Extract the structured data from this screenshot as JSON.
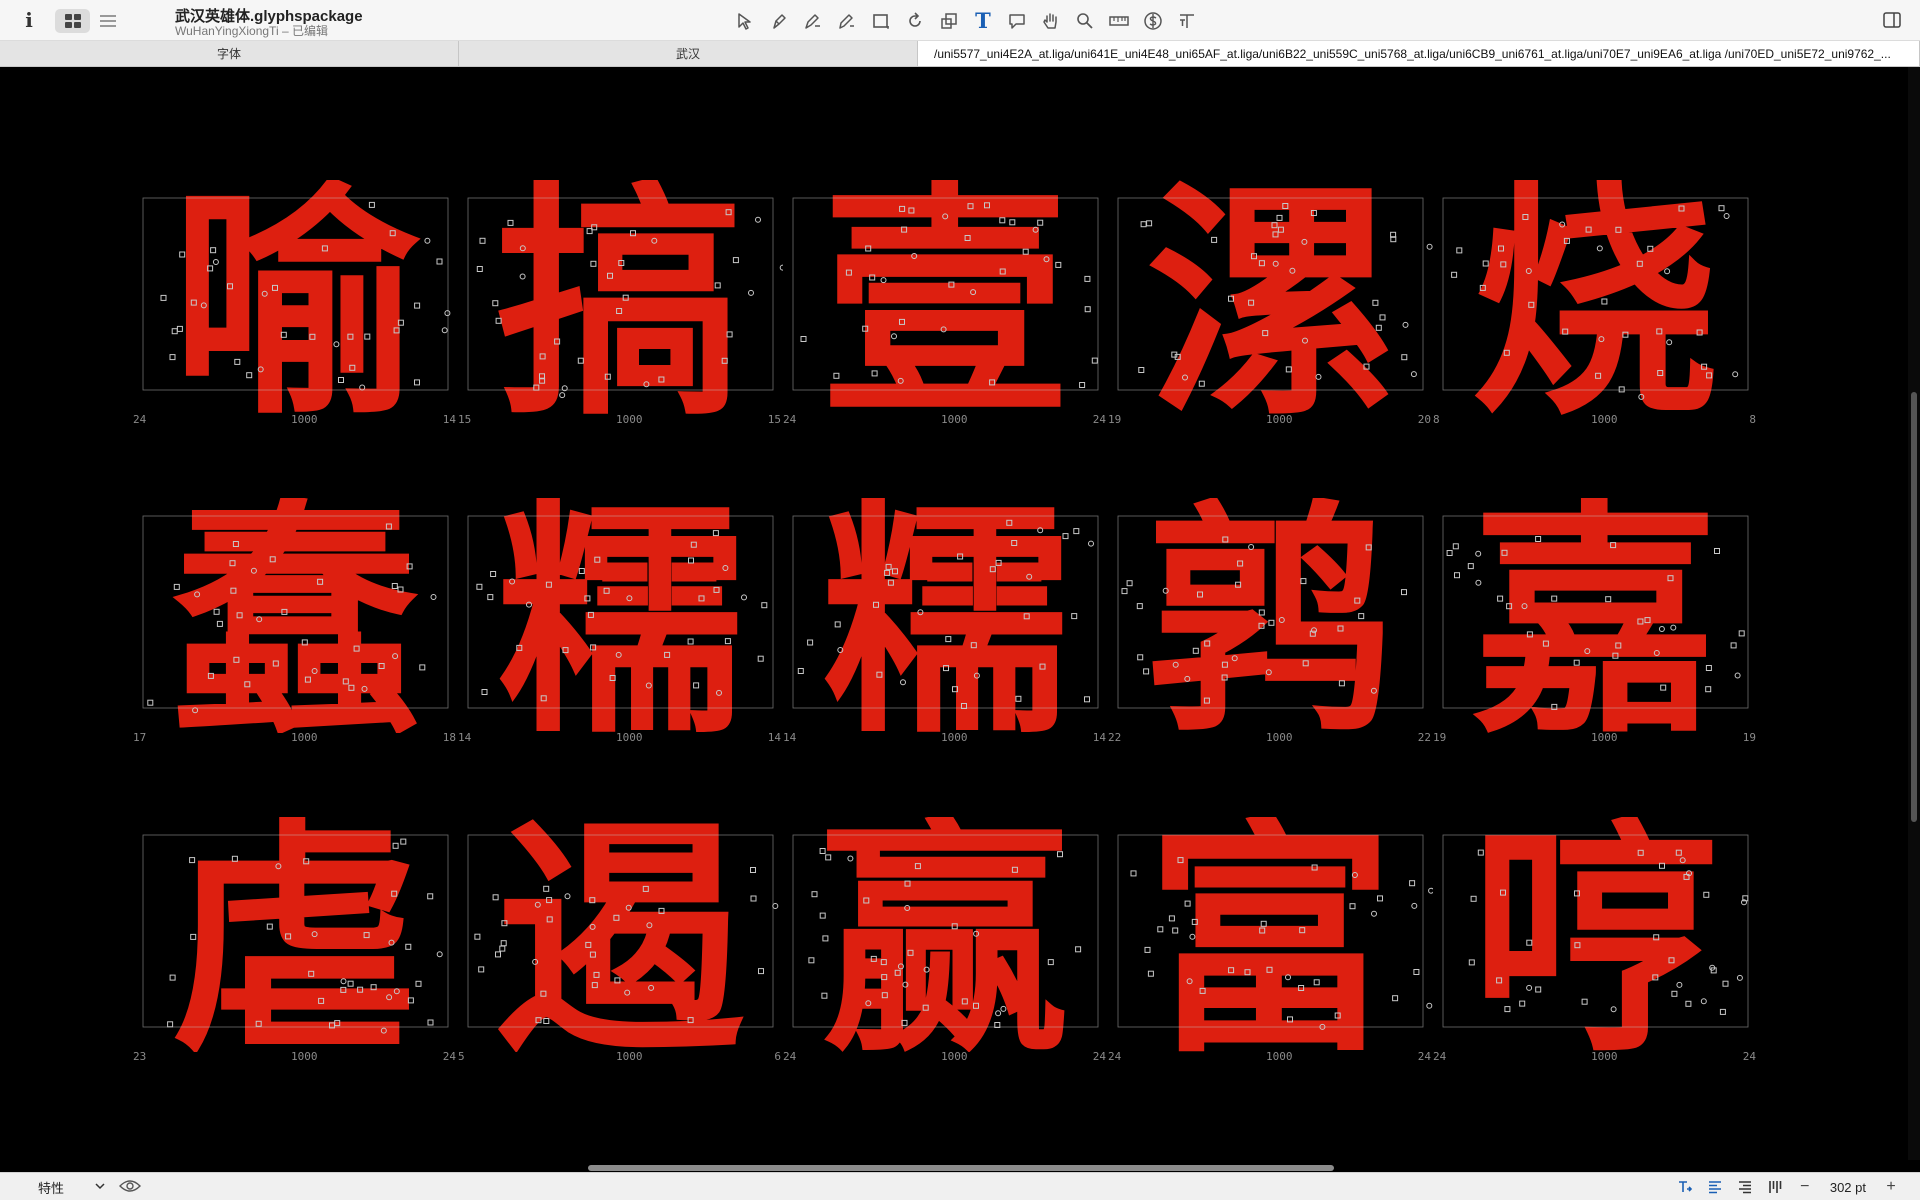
{
  "window": {
    "title": "武汉英雄体.glyphspackage",
    "subtitle": "WuHanYingXiongTi – 已编辑"
  },
  "toolbar": {
    "info_icon": "i",
    "view_modes": [
      "grid-view-icon",
      "list-view-icon"
    ],
    "active_view": "grid",
    "tools": [
      "select-icon",
      "draw-icon",
      "pen-icon",
      "pencil-icon",
      "rectangle-icon",
      "rotate-icon",
      "scale-icon",
      "text-tool-icon",
      "annotation-icon",
      "hand-icon",
      "zoom-icon",
      "measure-icon",
      "dollar-icon",
      "text-metrics-icon"
    ],
    "active_tool": "text-tool-icon",
    "text_tool_glyph": "T",
    "text_metrics_glyph": "⊤T"
  },
  "tabs": [
    {
      "label": "字体"
    },
    {
      "label": "武汉"
    },
    {
      "label": "/uni5577_uni4E2A_at.liga/uni641E_uni4E48_uni65AF_at.liga/uni6B22_uni559C_uni5768_at.liga/uni6CB9_uni6761_at.liga/uni70E7_uni9EA6_at.liga /uni70ED_uni5E72_uni9762_..."
    }
  ],
  "glyph_rows": [
    [
      {
        "char": "喻",
        "lsb": "24",
        "width": "1000",
        "rsb": "14"
      },
      {
        "char": "搞",
        "lsb": "15",
        "width": "1000",
        "rsb": "15"
      },
      {
        "char": "壹",
        "lsb": "24",
        "width": "1000",
        "rsb": "24"
      },
      {
        "char": "漯",
        "lsb": "19",
        "width": "1000",
        "rsb": "20"
      },
      {
        "char": "烧",
        "lsb": "8",
        "width": "1000",
        "rsb": "8"
      }
    ],
    [
      {
        "char": "蠢",
        "lsb": "17",
        "width": "1000",
        "rsb": "18"
      },
      {
        "char": "糯",
        "lsb": "14",
        "width": "1000",
        "rsb": "14"
      },
      {
        "char": "糯",
        "lsb": "14",
        "width": "1000",
        "rsb": "14"
      },
      {
        "char": "鹑",
        "lsb": "22",
        "width": "1000",
        "rsb": "22"
      },
      {
        "char": "嘉",
        "lsb": "19",
        "width": "1000",
        "rsb": "19"
      }
    ],
    [
      {
        "char": "虐",
        "lsb": "23",
        "width": "1000",
        "rsb": "24"
      },
      {
        "char": "遏",
        "lsb": "5",
        "width": "1000",
        "rsb": "6"
      },
      {
        "char": "赢",
        "lsb": "24",
        "width": "1000",
        "rsb": "24"
      },
      {
        "char": "富",
        "lsb": "24",
        "width": "1000",
        "rsb": "24"
      },
      {
        "char": "哼",
        "lsb": "24",
        "width": "1000",
        "rsb": "24"
      }
    ]
  ],
  "colors": {
    "glyph_fill": "#dd1f10",
    "outline": "#c8c8c8",
    "canvas_bg": "#000000",
    "accent": "#1a5fb4"
  },
  "bottombar": {
    "attributes_label": "特性",
    "eye_icon": "eye-icon",
    "zoom": "302 pt",
    "zoom_out": "−",
    "zoom_in": "+"
  }
}
